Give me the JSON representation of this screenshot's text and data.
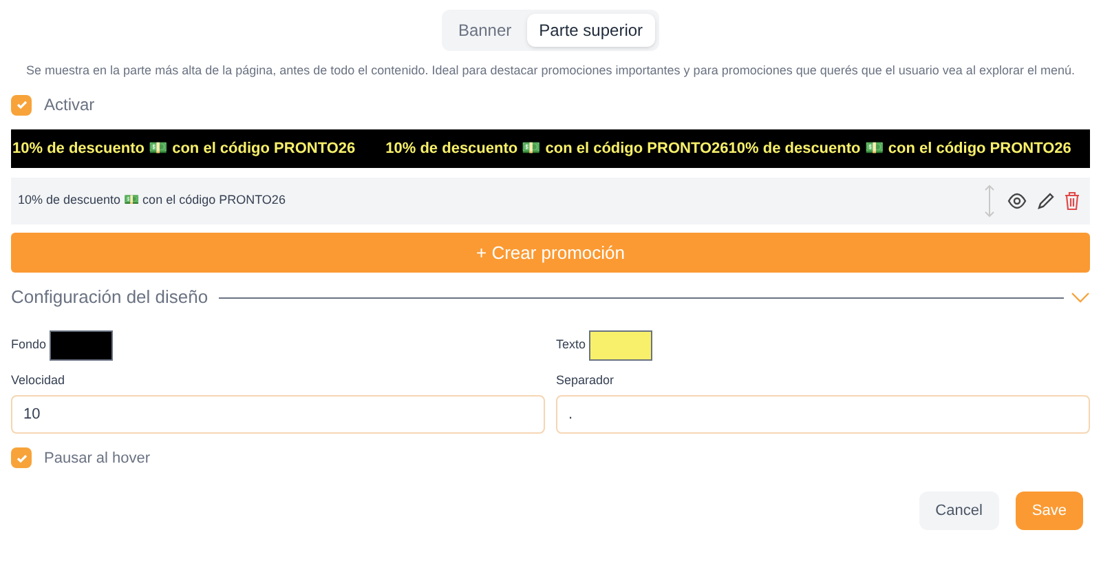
{
  "tabs": [
    {
      "label": "Banner",
      "selected": false
    },
    {
      "label": "Parte superior",
      "selected": true
    }
  ],
  "description": "Se muestra en la parte más alta de la página, antes de todo el contenido. Ideal para destacar promociones importantes y para promociones que querés que el usuario vea al explorar el menú.",
  "activate": {
    "label": "Activar",
    "checked": true
  },
  "marquee": {
    "items": [
      "10% de descuento 💵 con el código PRONTO26",
      "10% de descuento 💵 con el código PRONTO2610% de descuento 💵 con el código PRONTO26"
    ]
  },
  "promotions": [
    {
      "text": "10% de descuento 💵 con el código PRONTO26"
    }
  ],
  "create_button": "+ Crear promoción",
  "design": {
    "title": "Configuración del diseño",
    "expanded": true,
    "colors": [
      {
        "label": "Fondo",
        "color": "#000000"
      },
      {
        "label": "Texto",
        "color": "#f8f06a"
      }
    ],
    "fields": [
      {
        "label": "Velocidad",
        "value": "10"
      },
      {
        "label": "Separador",
        "value": "."
      }
    ],
    "pause": {
      "label": "Pausar al hover",
      "checked": true
    }
  },
  "buttons": {
    "cancel": "Cancel",
    "save": "Save"
  }
}
